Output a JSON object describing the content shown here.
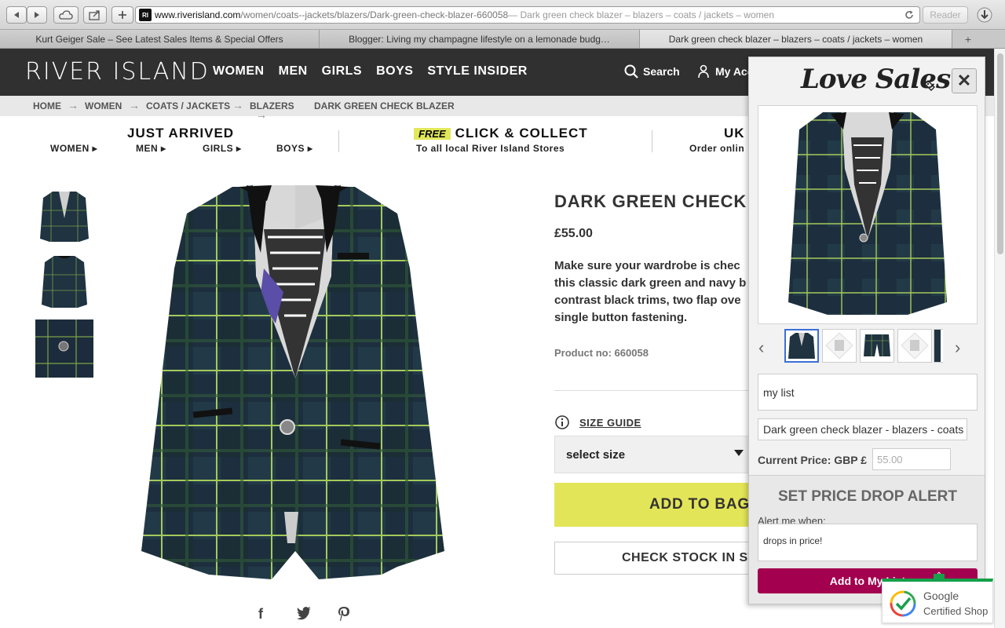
{
  "browser": {
    "url_host": "www.riverisland.com",
    "url_path": "/women/coats--jackets/blazers/Dark-green-check-blazer-660058",
    "url_title": " — Dark green check blazer – blazers – coats / jackets – women",
    "reader_label": "Reader",
    "tabs": [
      {
        "label": "Kurt Geiger Sale – See Latest Sales Items & Special Offers"
      },
      {
        "label": "Blogger: Living my champagne lifestyle on a lemonade budg…"
      },
      {
        "label": "Dark green check blazer – blazers – coats / jackets – women"
      }
    ],
    "new_tab_label": "+"
  },
  "header": {
    "logo": "RIVER ISLAND",
    "nav": [
      "WOMEN",
      "MEN",
      "GIRLS",
      "BOYS",
      "STYLE INSIDER"
    ],
    "search_label": "Search",
    "account_label": "My Acc"
  },
  "breadcrumb": [
    "HOME",
    "WOMEN",
    "COATS / JACKETS",
    "BLAZERS",
    "DARK GREEN CHECK BLAZER"
  ],
  "promo": {
    "just_arrived_title": "JUST ARRIVED",
    "just_arrived_links": [
      "WOMEN",
      "MEN",
      "GIRLS",
      "BOYS"
    ],
    "free_badge": "FREE",
    "click_collect_title": "CLICK & COLLECT",
    "click_collect_sub": "To all local River Island Stores",
    "uk_title": "UK",
    "uk_sub": "Order onlin"
  },
  "product": {
    "title": "DARK GREEN CHECK",
    "price": "£55.00",
    "description": "Make sure your wardrobe is chec this classic dark green and navy b contrast black trims, two flap ove single button fastening.",
    "product_no": "Product no: 660058",
    "size_guide": "SIZE GUIDE",
    "size_select": "select size",
    "add_to_bag": "ADD TO BAG",
    "check_stock": "CHECK STOCK IN ST"
  },
  "panel": {
    "logo": "Love Sales",
    "close": "✕",
    "list_name": "my list",
    "item_name": "Dark green check blazer - blazers - coats",
    "current_price_label": "Current Price:",
    "currency_label": "GBP £",
    "price_value": "55.00",
    "alert_title": "SET PRICE DROP ALERT",
    "alert_when": "Alert me when:",
    "alert_option": "drops in price!",
    "add_button": "Add to My List"
  },
  "google": {
    "line1": "Google",
    "line2": "Certified Shop"
  },
  "colors": {
    "header_bg": "#303030",
    "add_to_bag": "#e3e558",
    "panel_button": "#a3004f",
    "google_green": "#15a04a"
  }
}
